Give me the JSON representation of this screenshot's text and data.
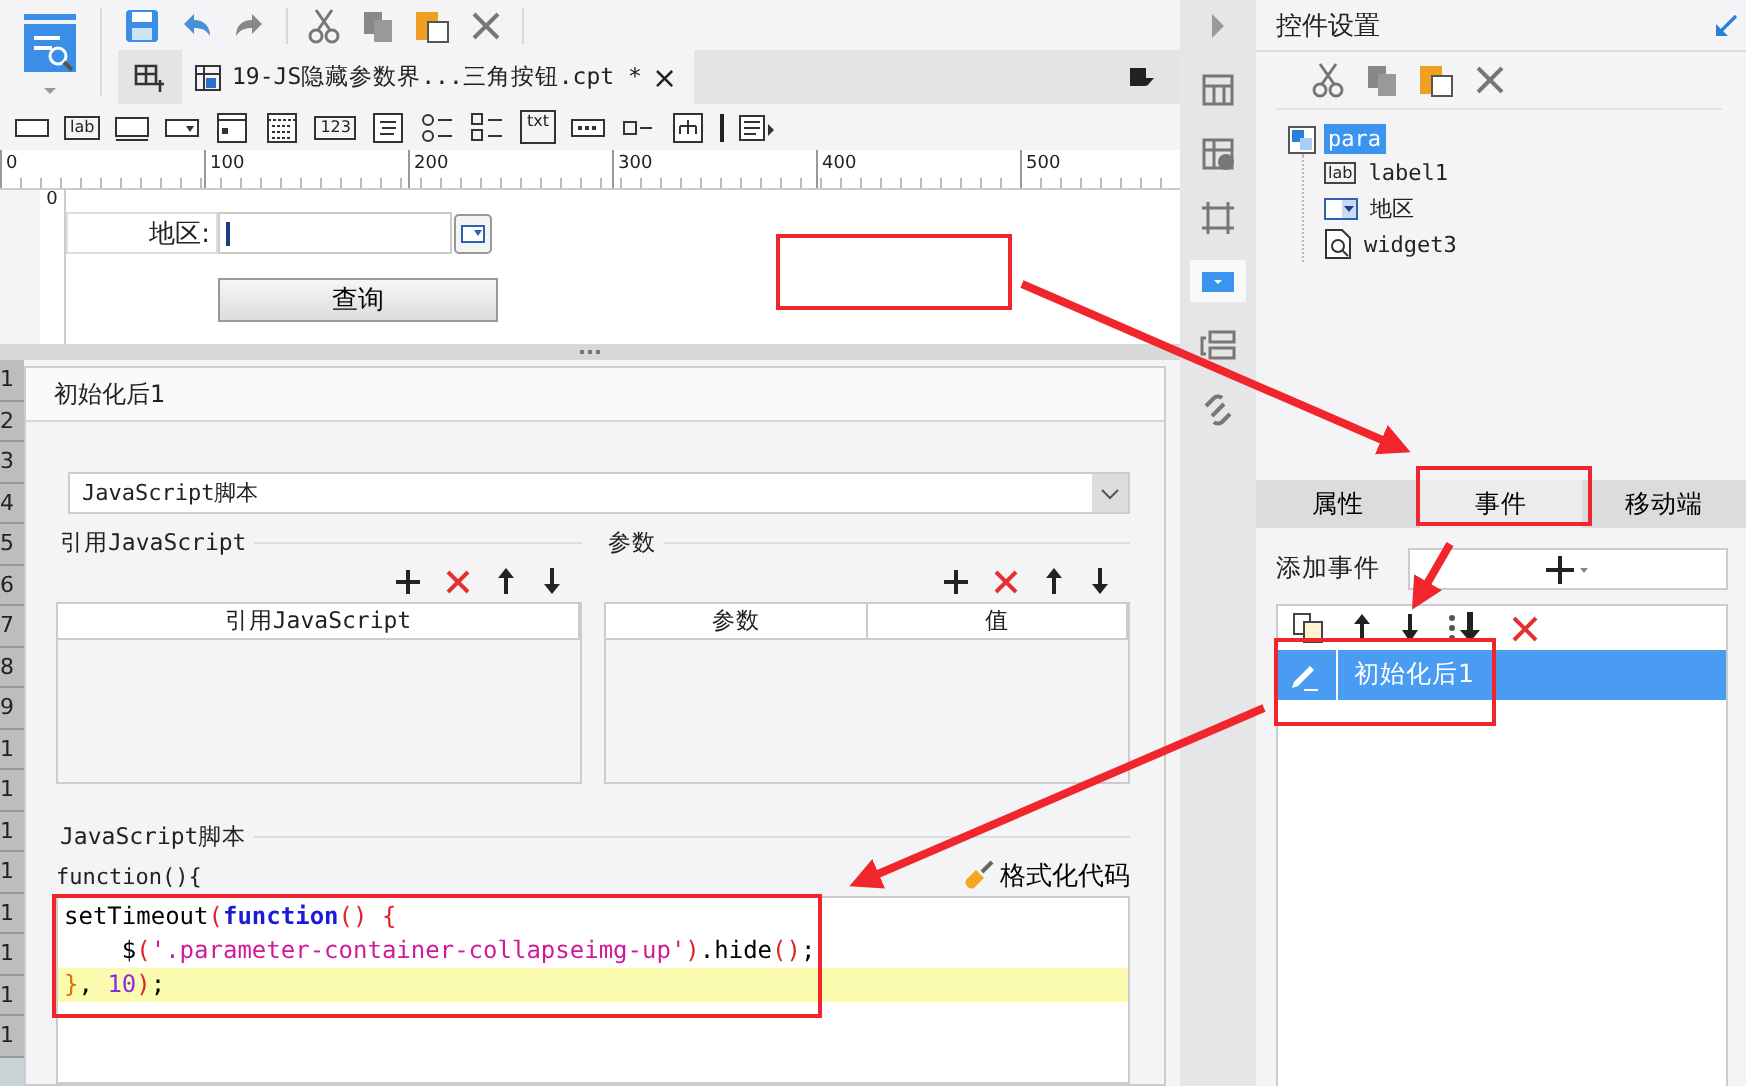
{
  "file_tab": {
    "title": "19-JS隐藏参数界...三角按钮.cpt *",
    "close": "×",
    "selected": true
  },
  "widget_toolbar": [
    {
      "kind": "textbox"
    },
    {
      "kind": "text",
      "text": "lab"
    },
    {
      "kind": "textarea"
    },
    {
      "kind": "combo"
    },
    {
      "kind": "datebox"
    },
    {
      "kind": "calendar"
    },
    {
      "kind": "text",
      "text": "123"
    },
    {
      "kind": "list"
    },
    {
      "kind": "radio"
    },
    {
      "kind": "checkbox"
    },
    {
      "kind": "boxed",
      "text": "txt"
    },
    {
      "kind": "password"
    },
    {
      "kind": "check"
    },
    {
      "kind": "tree"
    },
    {
      "kind": "separator"
    },
    {
      "kind": "more"
    }
  ],
  "ruler": {
    "ticks": [
      "0",
      "100",
      "200",
      "300",
      "400",
      "500"
    ],
    "vertical_tick": "0"
  },
  "parameter_form": {
    "label": "地区:",
    "query_button": "查询"
  },
  "row_numbers": [
    "1",
    "2",
    "3",
    "4",
    "5",
    "6",
    "7",
    "8",
    "9",
    "1",
    "1",
    "1",
    "1",
    "1",
    "1",
    "1",
    "1"
  ],
  "event_editor": {
    "title": "初始化后1",
    "type_select": "JavaScript脚本",
    "imports": {
      "title": "引用JavaScript",
      "columns": [
        "引用JavaScript"
      ]
    },
    "params": {
      "title": "参数",
      "columns": [
        "参数",
        "值"
      ]
    },
    "script_label": "JavaScript脚本",
    "function_header": "function(){",
    "format_button": "格式化代码",
    "code_lines": [
      {
        "highlighted": false,
        "tokens": [
          {
            "kind": "plain",
            "text": "setTimeout"
          },
          {
            "kind": "paren",
            "text": "("
          },
          {
            "kind": "keyword",
            "text": "function"
          },
          {
            "kind": "paren",
            "text": "() {"
          }
        ]
      },
      {
        "highlighted": false,
        "tokens": [
          {
            "kind": "plain",
            "text": "    $"
          },
          {
            "kind": "paren",
            "text": "("
          },
          {
            "kind": "string",
            "text": "'.parameter-container-collapseimg-up'"
          },
          {
            "kind": "paren",
            "text": ")"
          },
          {
            "kind": "plain",
            "text": ".hide"
          },
          {
            "kind": "paren",
            "text": "()"
          },
          {
            "kind": "plain",
            "text": ";"
          }
        ]
      },
      {
        "highlighted": true,
        "tokens": [
          {
            "kind": "brace",
            "text": "}"
          },
          {
            "kind": "plain",
            "text": ", "
          },
          {
            "kind": "number",
            "text": "10"
          },
          {
            "kind": "paren",
            "text": ")"
          },
          {
            "kind": "plain",
            "text": ";"
          }
        ]
      }
    ]
  },
  "side_strip": [
    {
      "kind": "expand",
      "selected": false
    },
    {
      "kind": "grid",
      "selected": false
    },
    {
      "kind": "grid-info",
      "selected": false
    },
    {
      "kind": "frame",
      "selected": false
    },
    {
      "kind": "dropdown",
      "selected": true
    },
    {
      "kind": "layout",
      "selected": false
    },
    {
      "kind": "link",
      "selected": false
    }
  ],
  "widget_settings": {
    "title": "控件设置",
    "tree": {
      "label": "para",
      "selected": true,
      "children": [
        {
          "label": "label1",
          "kind": "label",
          "icon_text": "lab",
          "selected": false
        },
        {
          "label": "地区",
          "kind": "combo",
          "selected": false
        },
        {
          "label": "widget3",
          "kind": "search",
          "selected": false
        }
      ]
    }
  },
  "property_tabs": [
    {
      "label": "属性",
      "selected": false
    },
    {
      "label": "事件",
      "selected": true
    },
    {
      "label": "移动端",
      "selected": false
    }
  ],
  "events": {
    "add_label": "添加事件",
    "items": [
      {
        "label": "初始化后1",
        "selected": true
      }
    ]
  }
}
